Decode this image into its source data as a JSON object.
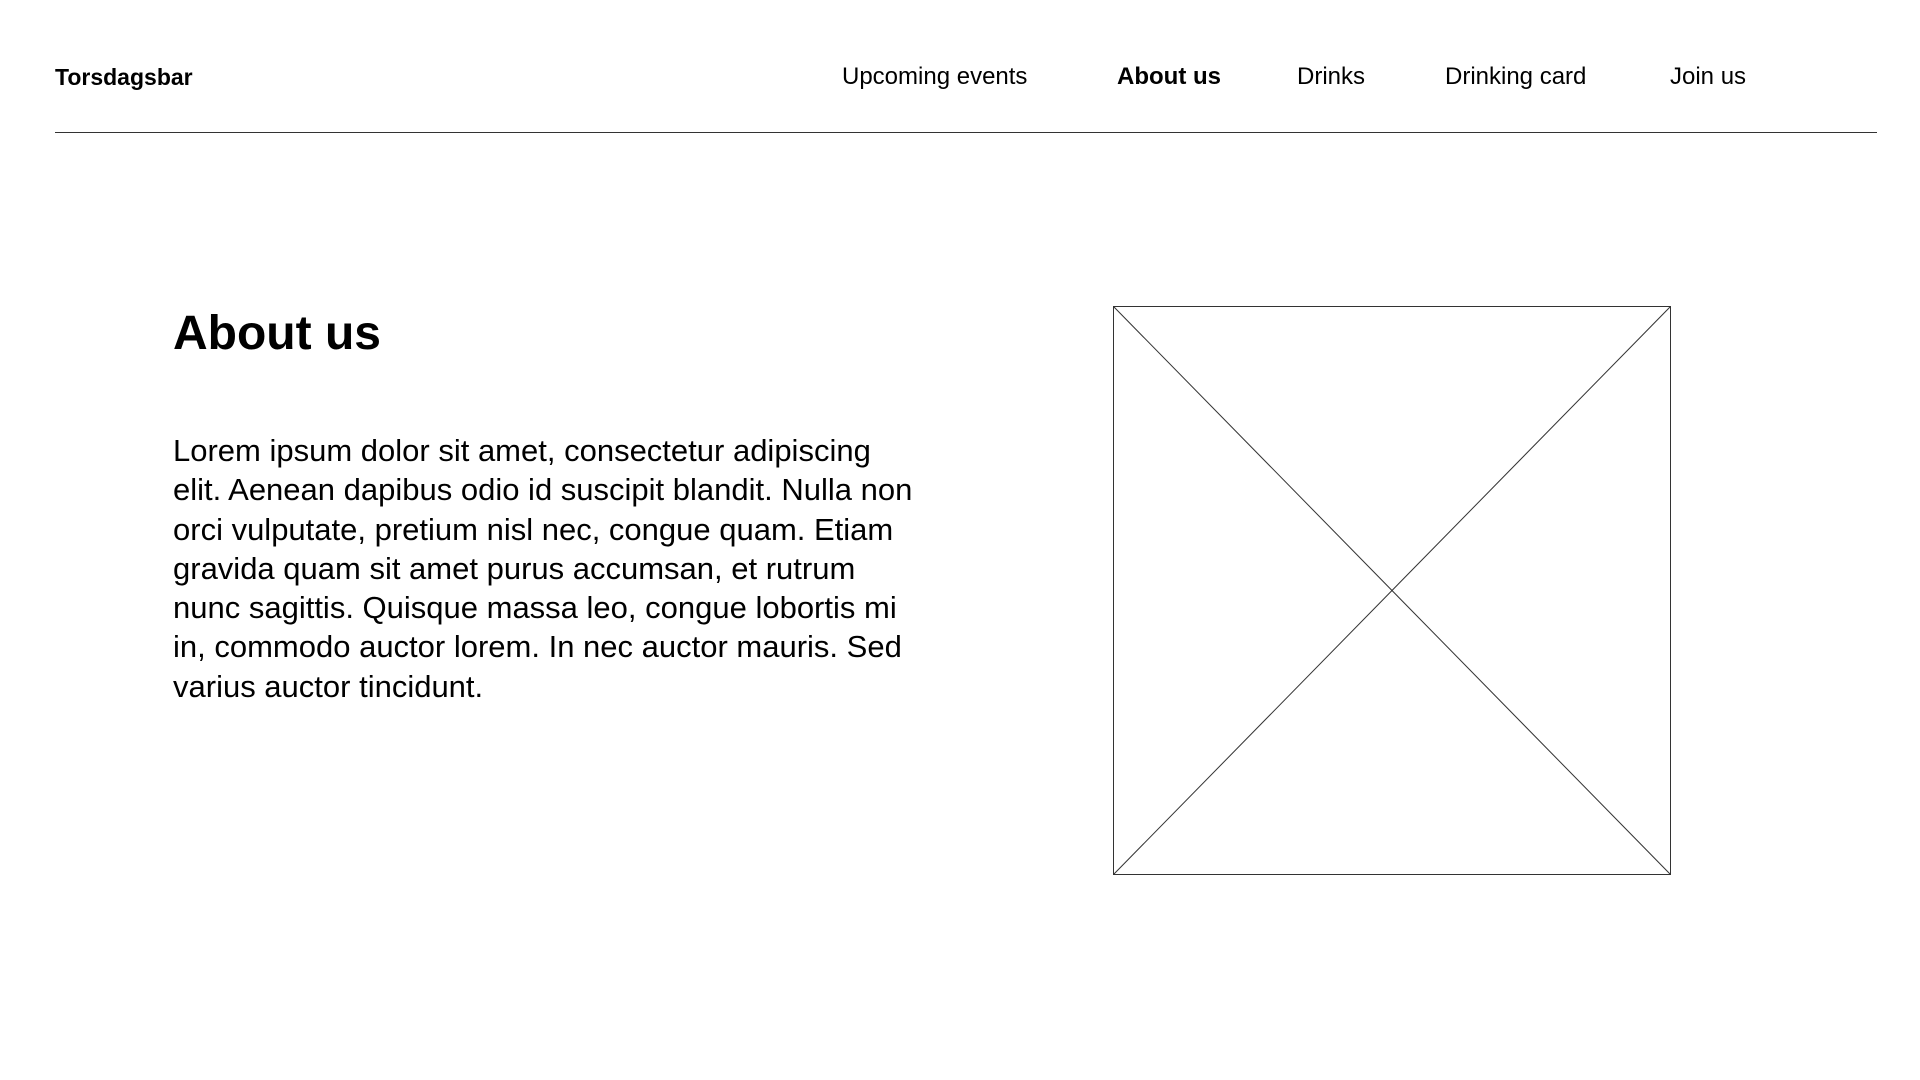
{
  "header": {
    "brand": "Torsdagsbar",
    "nav": [
      {
        "label": "Upcoming events",
        "active": false
      },
      {
        "label": "About us",
        "active": true
      },
      {
        "label": "Drinks",
        "active": false
      },
      {
        "label": "Drinking card",
        "active": false
      },
      {
        "label": "Join us",
        "active": false
      }
    ]
  },
  "main": {
    "title": "About us",
    "body": "Lorem ipsum dolor sit amet, consectetur adipiscing elit. Aenean dapibus odio id suscipit blandit. Nulla non orci vulputate, pretium nisl nec, congue quam. Etiam gravida quam sit amet purus accumsan, et rutrum nunc sagittis. Quisque massa leo, congue lobortis mi in, commodo auctor lorem. In nec auctor mauris. Sed varius auctor tincidunt.",
    "image_icon": "image-placeholder-icon"
  }
}
